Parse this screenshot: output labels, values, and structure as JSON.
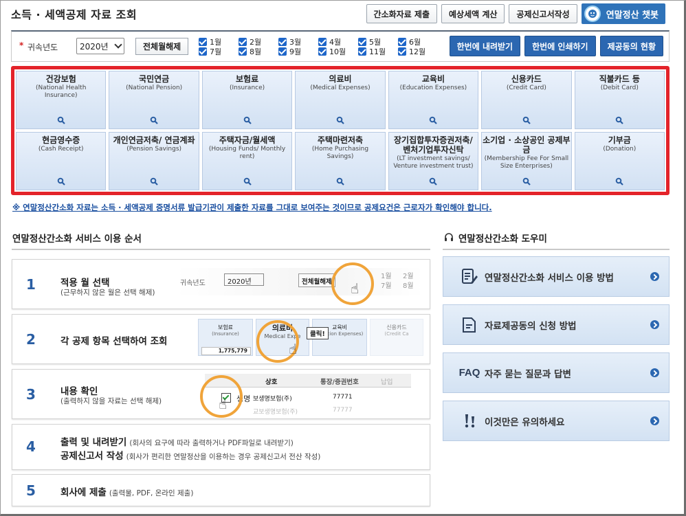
{
  "header": {
    "title": "소득 · 세액공제 자료 조회",
    "buttons": [
      "간소화자료 제출",
      "예상세액 계산",
      "공제신고서작성"
    ],
    "chatbot_label": "연말정산 챗봇"
  },
  "filter": {
    "required_mark": "*",
    "year_label": "귀속년도",
    "year_value": "2020년",
    "release_all_label": "전체월해제",
    "months": [
      {
        "label": "1월",
        "checked": true
      },
      {
        "label": "2월",
        "checked": true
      },
      {
        "label": "3월",
        "checked": true
      },
      {
        "label": "4월",
        "checked": true
      },
      {
        "label": "5월",
        "checked": true
      },
      {
        "label": "6월",
        "checked": true
      },
      {
        "label": "7월",
        "checked": true
      },
      {
        "label": "8월",
        "checked": true
      },
      {
        "label": "9월",
        "checked": true
      },
      {
        "label": "10월",
        "checked": true
      },
      {
        "label": "11월",
        "checked": true
      },
      {
        "label": "12월",
        "checked": true
      }
    ],
    "actions": [
      "한번에 내려받기",
      "한번에 인쇄하기",
      "제공동의 현황"
    ]
  },
  "tiles": [
    {
      "title": "건강보험",
      "sub": "(National Health Insurance)"
    },
    {
      "title": "국민연금",
      "sub": "(National Pension)"
    },
    {
      "title": "보험료",
      "sub": "(Insurance)"
    },
    {
      "title": "의료비",
      "sub": "(Medical Expenses)"
    },
    {
      "title": "교육비",
      "sub": "(Education Expenses)"
    },
    {
      "title": "신용카드",
      "sub": "(Credit Card)"
    },
    {
      "title": "직불카드 등",
      "sub": "(Debit Card)"
    },
    {
      "title": "현금영수증",
      "sub": "(Cash Receipt)"
    },
    {
      "title": "개인연금저축/ 연금계좌",
      "sub": "(Pension Savings)"
    },
    {
      "title": "주택자금/월세액",
      "sub": "(Housing Funds/ Monthly rent)"
    },
    {
      "title": "주택마련저축",
      "sub": "(Home Purchasing Savings)"
    },
    {
      "title": "장기집합투자증권저축/ 벤처기업투자신탁",
      "sub": "(LT investment savings/ Venture investment trust)"
    },
    {
      "title": "소기업 · 소상공인 공제부금",
      "sub": "(Membership Fee For Small Size Enterprises)"
    },
    {
      "title": "기부금",
      "sub": "(Donation)"
    }
  ],
  "notice": "※ 연말정산간소화 자료는 소득 · 세액공제 증명서류 발급기관이 제출한 자료를 그대로 보여주는 것이므로 공제요건은 근로자가 확인해야 합니다.",
  "steps_section": {
    "title": "연말정산간소화 서비스 이용 순서",
    "steps": [
      {
        "num": "1",
        "title": "적용 월 선택",
        "desc": "(근무하지 않은 월은 선택 해제)"
      },
      {
        "num": "2",
        "title": "각 공제 항목 선택하여 조회",
        "desc": ""
      },
      {
        "num": "3",
        "title": "내용 확인",
        "desc": "(출력하지 않을 자료는 선택 해제)"
      },
      {
        "num": "4",
        "title": "출력 및 내려받기",
        "title2": "공제신고서 작성",
        "desc": "(회사의 요구에 따라 출력하거나 PDF파일로 내려받기)",
        "desc2": "(회사가 편리한 연말정산을 이용하는 경우 공제신고서 전산 작성)"
      },
      {
        "num": "5",
        "title": "회사에 제출",
        "desc": "(출력물, PDF, 온라인 제출)"
      }
    ]
  },
  "step_previews": {
    "step1": {
      "year_label": "귀속년도",
      "year_value": "2020년",
      "release_label": "전체월해제",
      "months": [
        "1월",
        "2월",
        "7월",
        "8월"
      ]
    },
    "step2": {
      "tiles": [
        "보험료",
        "의료비",
        "교육비",
        "신용카드"
      ],
      "subs": [
        "(Insurance)",
        "Medical Expe",
        "ducation Expenses)",
        "(Credit Ca"
      ],
      "amount": "1,775,779",
      "click_label": "클릭!"
    },
    "step3": {
      "col1": "상호",
      "col2": "통장/증권번호",
      "col3": "납입",
      "row1_name": "생명",
      "row1_rest": "보생명보험(주)",
      "row1_num": "77771",
      "row2_name": "교보생명보험(주)",
      "row2_num": "77777"
    }
  },
  "helper_section": {
    "title": "연말정산간소화 도우미",
    "items": [
      {
        "label": "연말정산간소화 서비스 이용 방법",
        "icon": "guide-icon"
      },
      {
        "label": "자료제공동의 신청 방법",
        "icon": "document-icon"
      },
      {
        "label": "자주 묻는 질문과 답변",
        "prefix": "FAQ",
        "icon": "faq-icon"
      },
      {
        "label": "이것만은 유의하세요",
        "icon": "warning-icon"
      }
    ]
  }
}
